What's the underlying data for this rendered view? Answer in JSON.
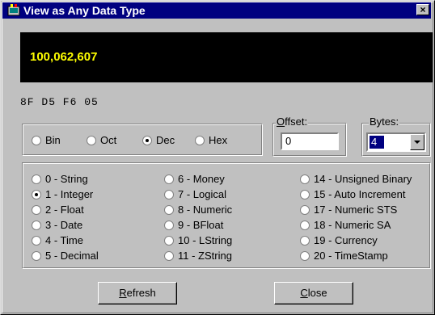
{
  "window": {
    "title": "View as Any Data Type",
    "close_label": "×"
  },
  "display": {
    "value": "100,062,607"
  },
  "hex_bytes": "8F D5 F6 05",
  "base": {
    "options": [
      {
        "label": "Bin",
        "selected": false
      },
      {
        "label": "Oct",
        "selected": false
      },
      {
        "label": "Dec",
        "selected": true
      },
      {
        "label": "Hex",
        "selected": false
      }
    ]
  },
  "offset": {
    "label_first": "O",
    "label_rest": "ffset:",
    "value": "0"
  },
  "bytes": {
    "label": "Bytes:",
    "value": "4"
  },
  "types": {
    "col1": [
      {
        "label": "0 - String",
        "selected": false
      },
      {
        "label": "1 - Integer",
        "selected": true
      },
      {
        "label": "2 - Float",
        "selected": false
      },
      {
        "label": "3 - Date",
        "selected": false
      },
      {
        "label": "4 - Time",
        "selected": false
      },
      {
        "label": "5 - Decimal",
        "selected": false
      }
    ],
    "col2": [
      {
        "label": "6 - Money",
        "selected": false
      },
      {
        "label": "7 - Logical",
        "selected": false
      },
      {
        "label": "8 - Numeric",
        "selected": false
      },
      {
        "label": "9 - BFloat",
        "selected": false
      },
      {
        "label": "10 - LString",
        "selected": false
      },
      {
        "label": "11 - ZString",
        "selected": false
      }
    ],
    "col3": [
      {
        "label": "14 - Unsigned Binary",
        "selected": false
      },
      {
        "label": "15 - Auto Increment",
        "selected": false
      },
      {
        "label": "17 - Numeric STS",
        "selected": false
      },
      {
        "label": "18 - Numeric SA",
        "selected": false
      },
      {
        "label": "19 - Currency",
        "selected": false
      },
      {
        "label": "20 - TimeStamp",
        "selected": false
      }
    ]
  },
  "buttons": {
    "refresh_first": "R",
    "refresh_rest": "efresh",
    "close_first": "C",
    "close_rest": "lose"
  },
  "colors": {
    "title_bg": "#000080",
    "display_bg": "#000000",
    "display_text": "#ffff00",
    "face": "#c0c0c0"
  }
}
